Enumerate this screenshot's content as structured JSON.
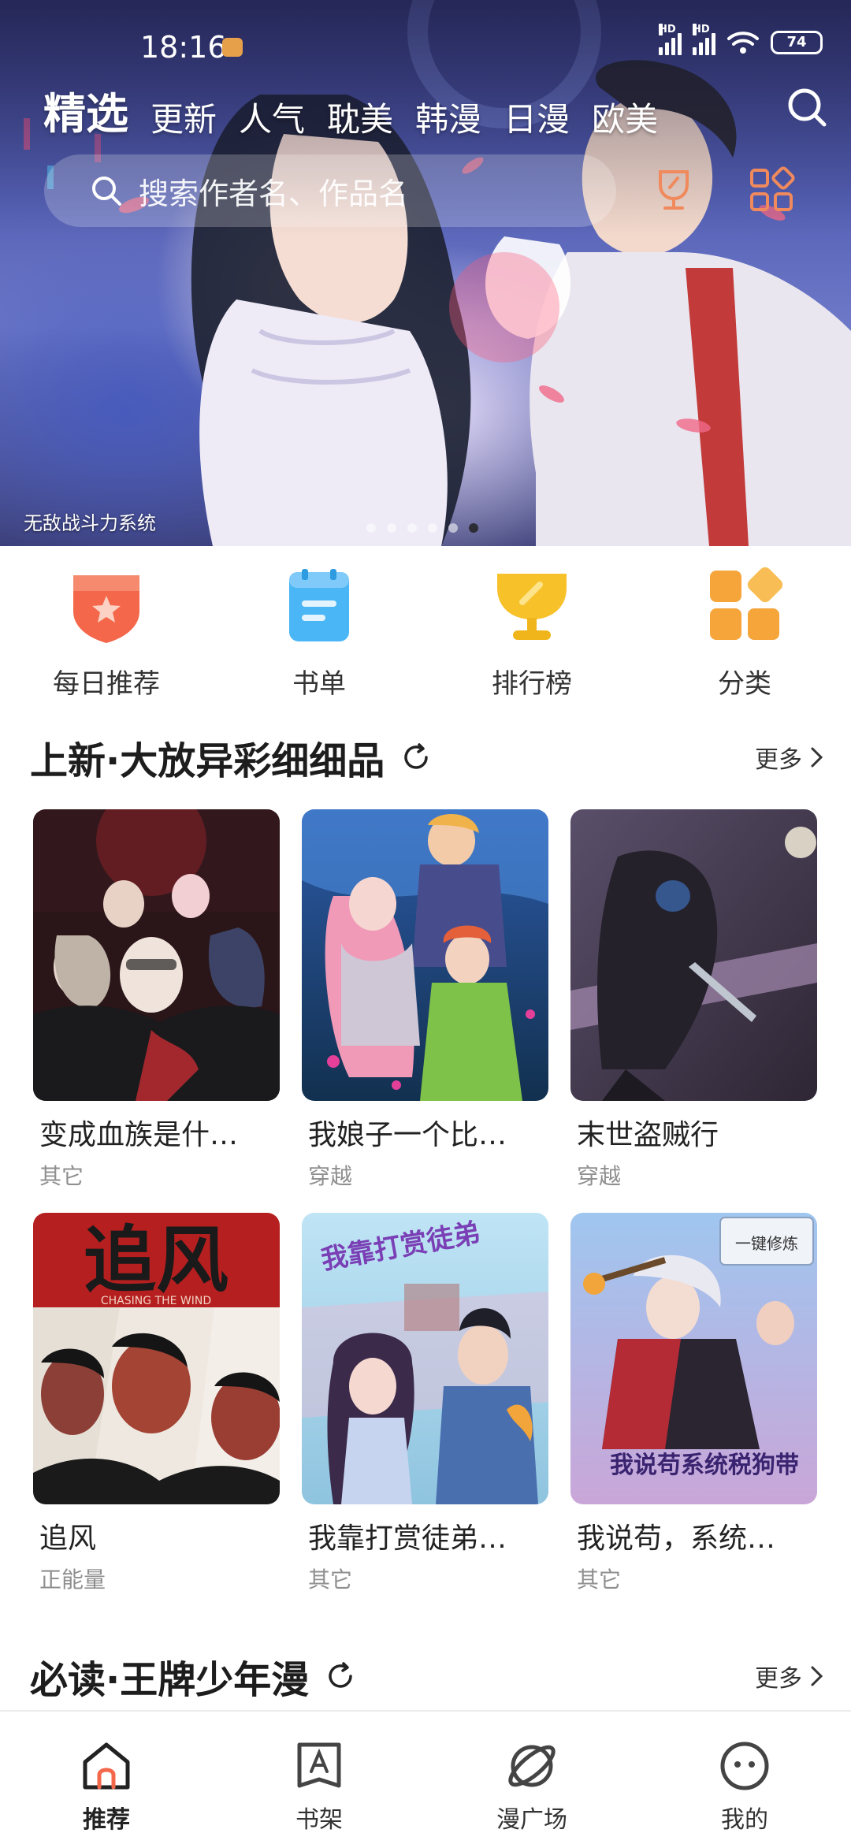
{
  "status_bar": {
    "time": "18:16",
    "network_1": "HD",
    "network_2": "HD",
    "battery": "74"
  },
  "top_tabs": [
    {
      "label": "精选",
      "active": true
    },
    {
      "label": "更新"
    },
    {
      "label": "人气"
    },
    {
      "label": "耽美"
    },
    {
      "label": "韩漫"
    },
    {
      "label": "日漫"
    },
    {
      "label": "欧美"
    }
  ],
  "search": {
    "placeholder": "搜索作者名、作品名",
    "icon": "search-icon"
  },
  "banner": {
    "caption": "无敌战斗力系统",
    "dots_total": 6,
    "active_dot": 6
  },
  "quick_entries": [
    {
      "label": "每日推荐",
      "icon": "daily-recommend-icon",
      "color": "#f4674a"
    },
    {
      "label": "书单",
      "icon": "booklist-icon",
      "color": "#4ab6f5"
    },
    {
      "label": "排行榜",
      "icon": "trophy-icon",
      "color": "#f7c12a"
    },
    {
      "label": "分类",
      "icon": "category-icon",
      "color": "#f6a53a"
    }
  ],
  "sections": [
    {
      "title": "上新·大放异彩细细品",
      "more": "更多",
      "items": [
        {
          "title": "变成血族是什…",
          "genre": "其它"
        },
        {
          "title": "我娘子一个比…",
          "genre": "穿越"
        },
        {
          "title": "末世盗贼行",
          "genre": "穿越"
        },
        {
          "title": "追风",
          "genre": "正能量",
          "cover_text": "追风",
          "cover_sub": "CHASING THE WIND"
        },
        {
          "title": "我靠打赏徒弟…",
          "genre": "其它",
          "cover_text": "我靠打赏徒弟"
        },
        {
          "title": "我说苟，系统…",
          "genre": "其它",
          "cover_text": "我说苟系统税狗带",
          "cover_popup": "一键修炼"
        }
      ]
    },
    {
      "title": "必读·王牌少年漫",
      "more": "更多"
    }
  ],
  "bottom_nav": [
    {
      "label": "推荐",
      "icon": "home-icon",
      "active": true
    },
    {
      "label": "书架",
      "icon": "bookshelf-icon"
    },
    {
      "label": "漫广场",
      "icon": "planet-icon"
    },
    {
      "label": "我的",
      "icon": "profile-icon"
    }
  ],
  "colors": {
    "accent_orange": "#f4674a",
    "accent_blue": "#4ab6f5",
    "accent_yellow": "#f7c12a",
    "secondary_text": "#8f8f8f"
  }
}
